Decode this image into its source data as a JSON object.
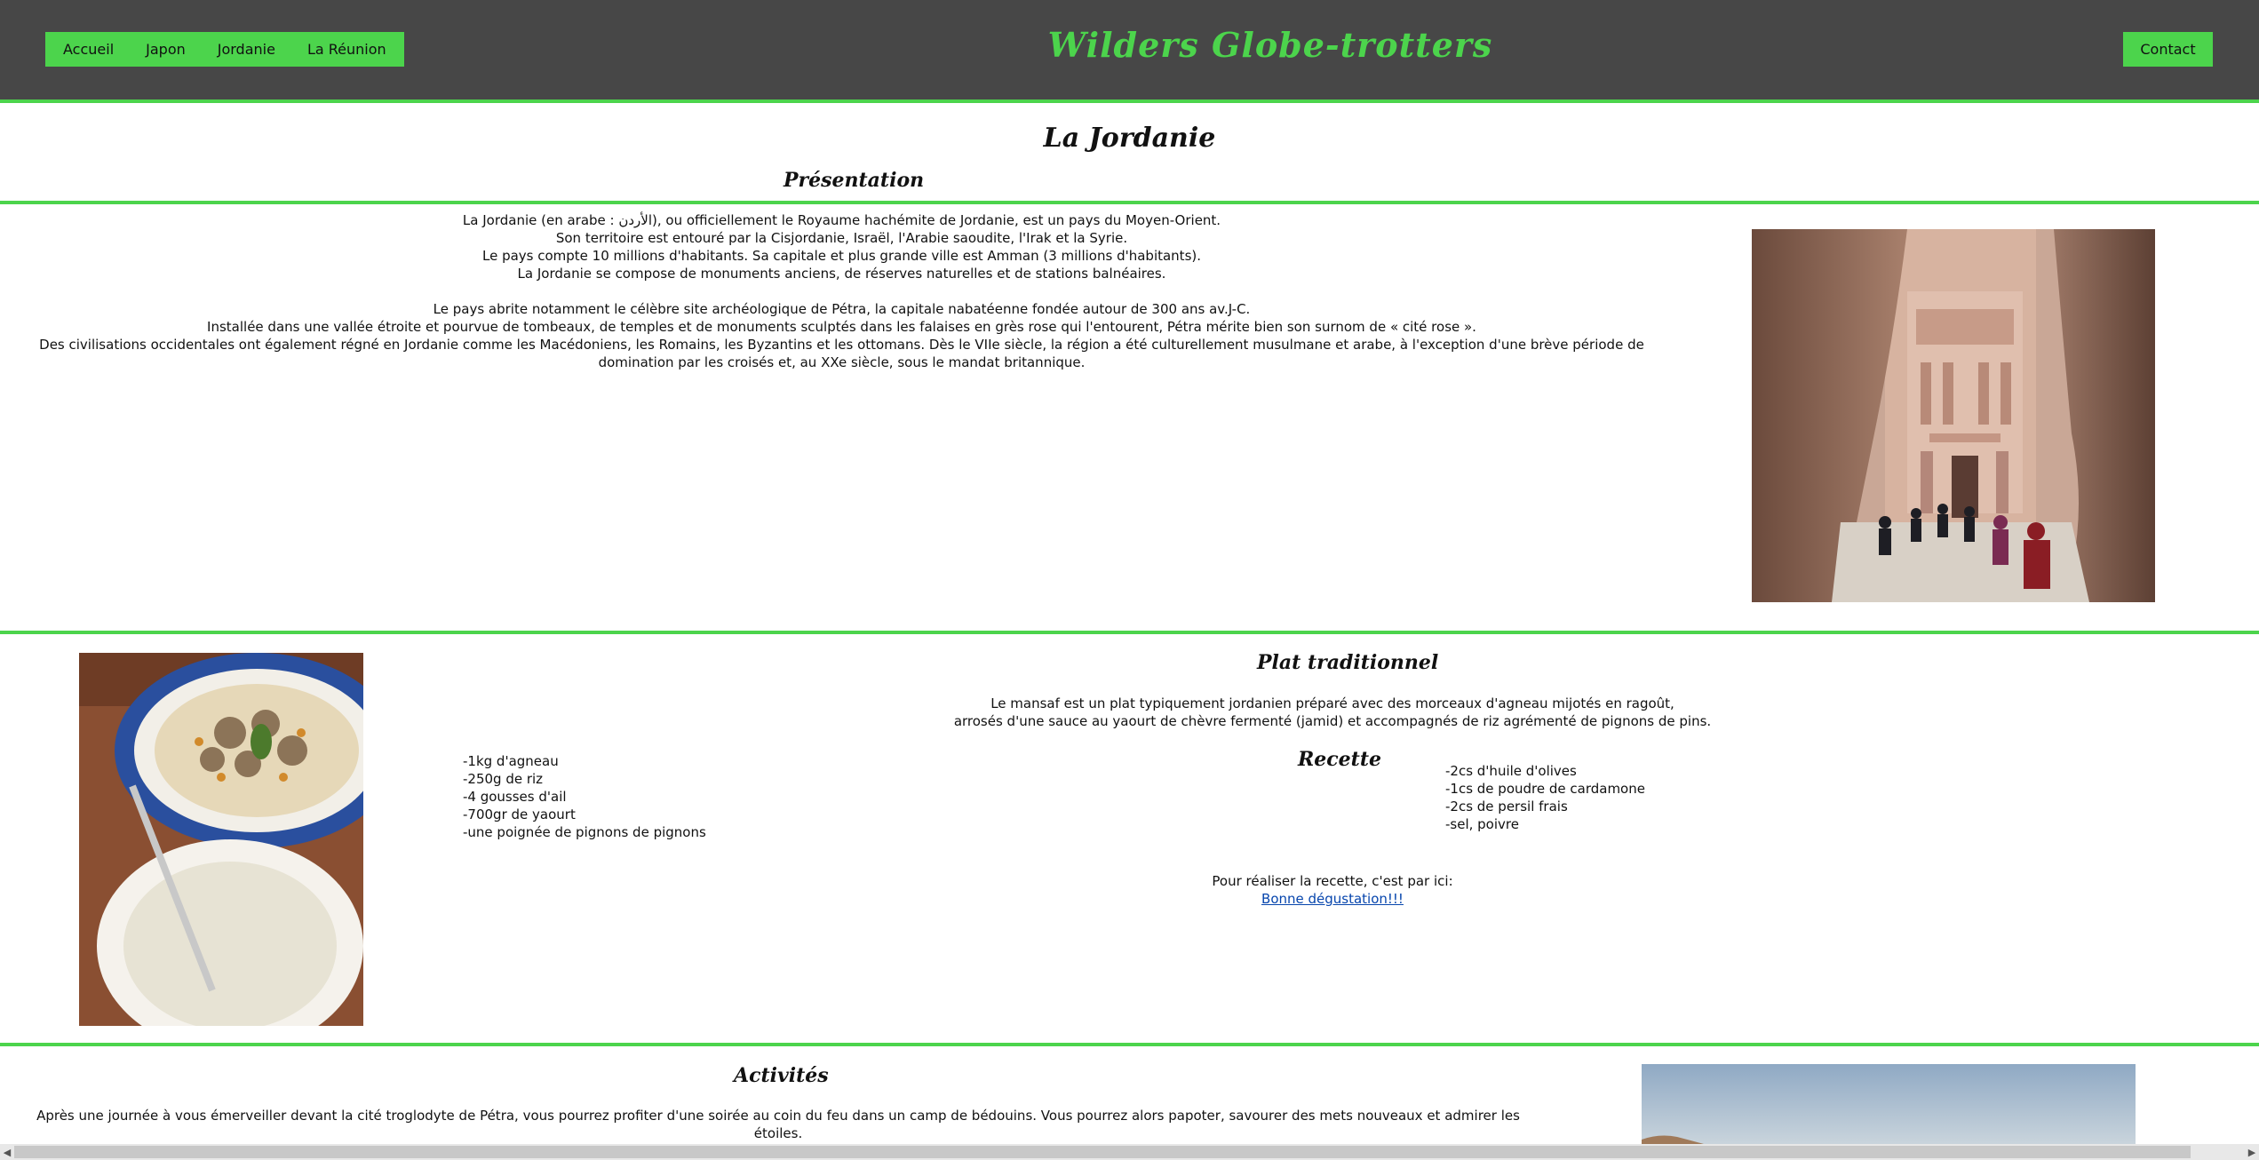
{
  "nav": {
    "items": [
      "Accueil",
      "Japon",
      "Jordanie",
      "La Réunion"
    ],
    "contact": "Contact"
  },
  "site_title": "Wilders Globe-trotters",
  "page_title": "La Jordanie",
  "presentation": {
    "title": "Présentation",
    "lines": [
      "La Jordanie (en arabe : الأردن), ou officiellement le Royaume hachémite de Jordanie, est un pays du Moyen-Orient.",
      "Son territoire est entouré par la Cisjordanie, Israël, l'Arabie saoudite, l'Irak et la Syrie.",
      "Le pays compte 10 millions d'habitants. Sa capitale et plus grande ville est Amman (3 millions d'habitants).",
      "La Jordanie se compose de monuments anciens, de réserves naturelles et de stations balnéaires."
    ],
    "lines2": [
      "Le pays abrite notamment le célèbre site archéologique de Pétra, la capitale nabatéenne fondée autour de 300 ans av.J-C.",
      "Installée dans une vallée étroite et pourvue de tombeaux, de temples et de monuments sculptés dans les falaises en grès rose qui l'entourent, Pétra mérite bien son surnom de « cité rose ».",
      "Des civilisations occidentales ont également régné en Jordanie comme les Macédoniens, les Romains, les Byzantins et les ottomans. Dès le VIIe siècle, la région a été culturellement musulmane et arabe, à l'exception d'une brève période de domination par les croisés et, au XXe siècle, sous le mandat britannique."
    ]
  },
  "dish": {
    "title": "Plat traditionnel",
    "lines": [
      "Le mansaf est un plat typiquement jordanien préparé avec des morceaux d'agneau mijotés en ragoût,",
      "arrosés d'une sauce au yaourt de chèvre fermenté (jamid) et accompagnés de riz agrémenté de pignons de pins."
    ],
    "recipe_title": "Recette",
    "ingredients_left": [
      "-1kg d'agneau",
      "-250g de riz",
      "-4 gousses d'ail",
      "-700gr de yaourt",
      "-une poignée de pignons de pignons"
    ],
    "ingredients_right": [
      "-2cs d'huile d'olives",
      "-1cs de poudre de cardamone",
      "-2cs de persil frais",
      "-sel, poivre"
    ],
    "recipe_prompt": "Pour réaliser la recette, c'est par ici:",
    "recipe_link": "Bonne dégustation!!!"
  },
  "activities": {
    "title": "Activités",
    "text": "Après une journée à vous émerveiller devant la cité troglodyte de Pétra, vous pourrez profiter d'une soirée au coin du feu dans un camp de bédouins. Vous pourrez alors papoter, savourer des mets nouveaux et admirer les étoiles."
  },
  "colors": {
    "accent": "#4cd44c",
    "header_bg": "#474747",
    "link": "#0645ad"
  }
}
